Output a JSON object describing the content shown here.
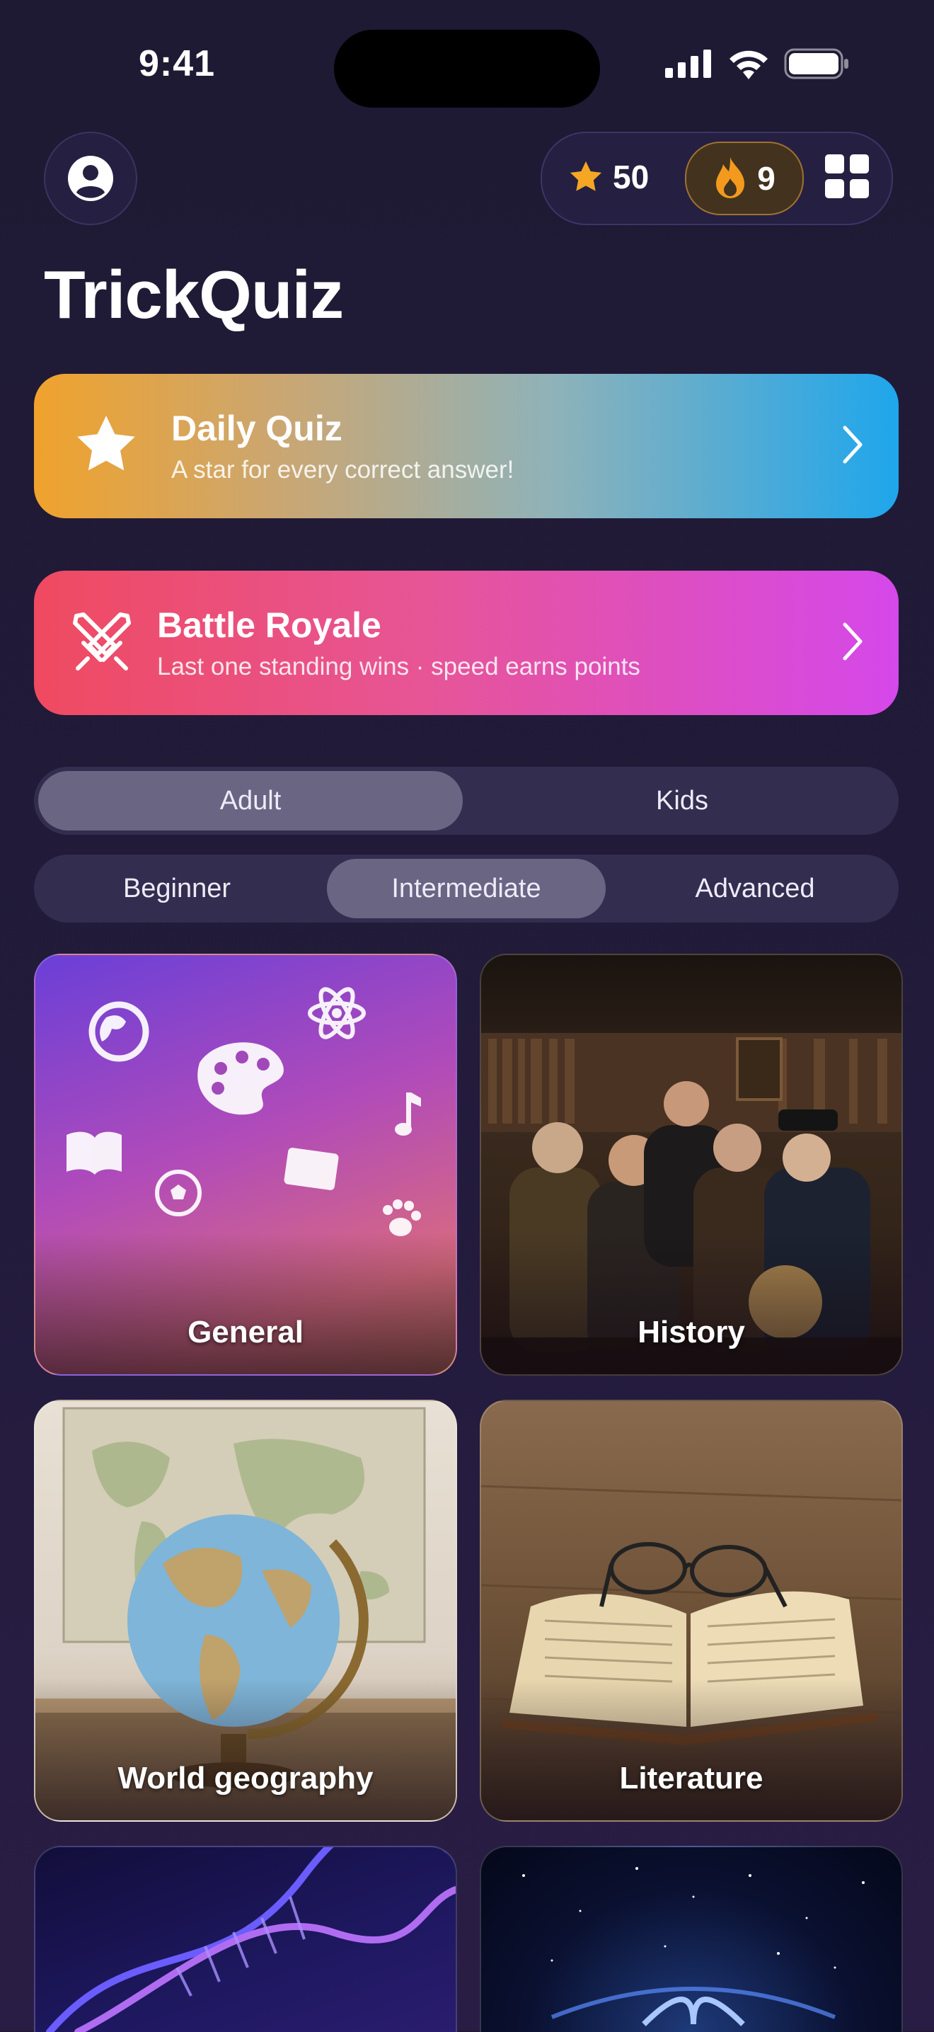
{
  "status": {
    "time": "9:41"
  },
  "header": {
    "stars": "50",
    "streak": "9",
    "title": "TrickQuiz"
  },
  "promos": {
    "daily": {
      "title": "Daily Quiz",
      "subtitle": "A star for every correct answer!"
    },
    "battle": {
      "title": "Battle Royale",
      "subtitle": "Last one standing wins · speed earns points"
    }
  },
  "audience": {
    "options": [
      "Adult",
      "Kids"
    ],
    "selected": "Adult"
  },
  "difficulty": {
    "options": [
      "Beginner",
      "Intermediate",
      "Advanced"
    ],
    "selected": "Intermediate"
  },
  "categories": [
    {
      "label": "General"
    },
    {
      "label": "History"
    },
    {
      "label": "World geography"
    },
    {
      "label": "Literature"
    },
    {
      "label": ""
    },
    {
      "label": ""
    }
  ],
  "colors": {
    "background": "#1e1a33",
    "accent_star": "#f5a623",
    "streak_flame": "#f39a1e",
    "daily_gradient": [
      "#f0a22c",
      "#1fa6ec"
    ],
    "battle_gradient": [
      "#ef4a60",
      "#d548ea"
    ],
    "general_gradient": [
      "#6a3fd8",
      "#d86a80"
    ]
  },
  "icons": {
    "profile": "person-circle-icon",
    "star": "star-icon",
    "streak": "flame-icon",
    "menu": "grid-icon",
    "daily": "star-icon",
    "battle": "crossed-swords-icon",
    "chevron": "chevron-right-icon"
  }
}
